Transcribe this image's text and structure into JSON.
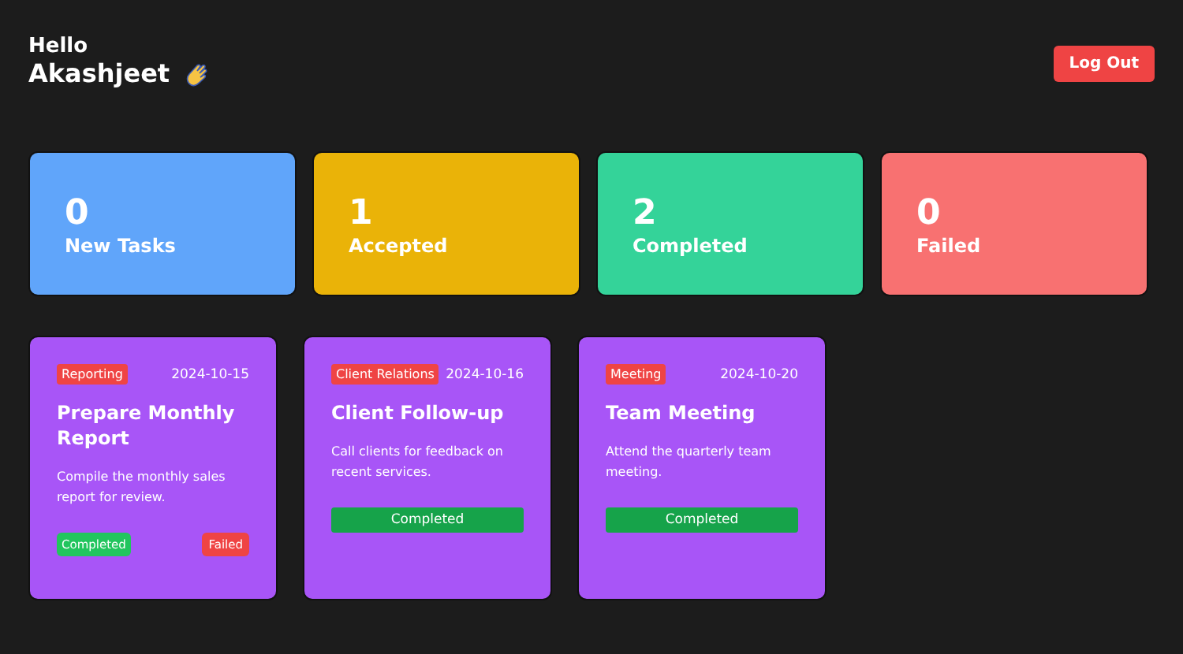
{
  "header": {
    "greeting": "Hello",
    "name": "Akashjeet",
    "logout_button": "Log Out"
  },
  "stats": [
    {
      "count": "0",
      "label": "New Tasks",
      "color": "#60a5fa"
    },
    {
      "count": "1",
      "label": "Accepted",
      "color": "#eab308"
    },
    {
      "count": "2",
      "label": "Completed",
      "color": "#34d399"
    },
    {
      "count": "0",
      "label": "Failed",
      "color": "#f87171"
    }
  ],
  "tasks": [
    {
      "kind": "accepted",
      "category": "Reporting",
      "date": "2024-10-15",
      "title": "Prepare Monthly Report",
      "description": "Compile the monthly sales report for review.",
      "actions": [
        "Completed",
        "Failed"
      ]
    },
    {
      "kind": "completed",
      "category": "Client Relations",
      "date": "2024-10-16",
      "title": "Client Follow-up",
      "description": "Call clients for feedback on recent services.",
      "status": "Completed"
    },
    {
      "kind": "completed",
      "category": "Meeting",
      "date": "2024-10-20",
      "title": "Team Meeting",
      "description": "Attend the quarterly team meeting.",
      "status": "Completed"
    }
  ]
}
